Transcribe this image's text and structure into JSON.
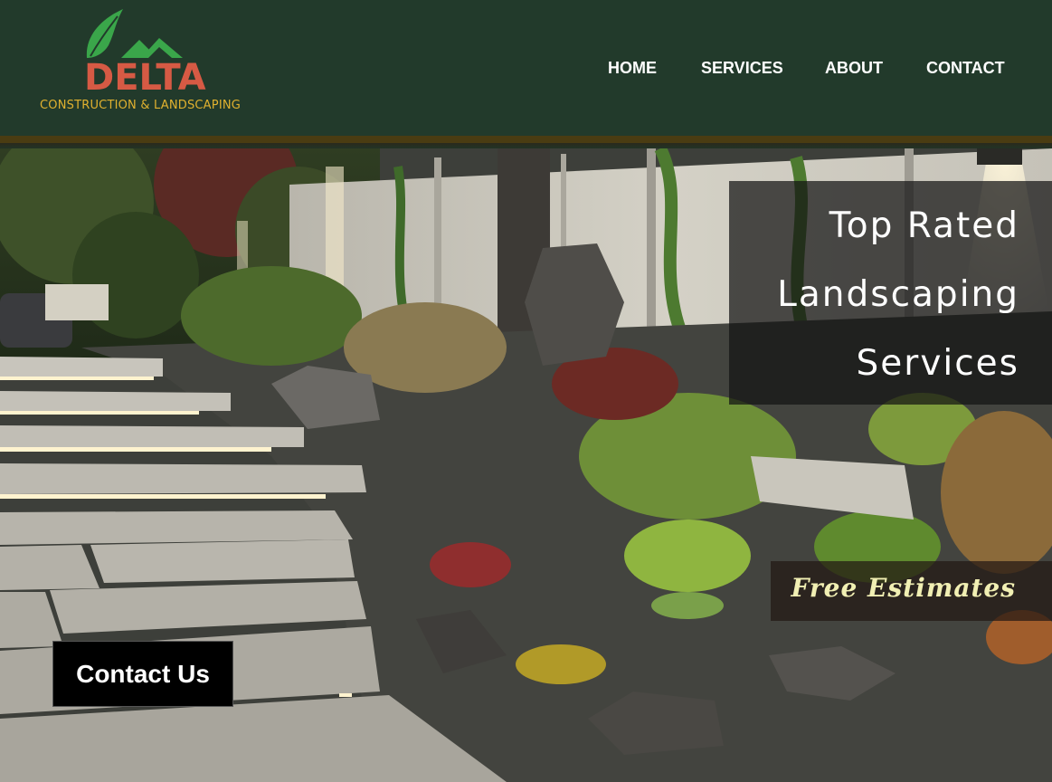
{
  "brand": {
    "name": "DELTA",
    "tagline": "CONSTRUCTION & LANDSCAPING",
    "colors": {
      "leaf": "#3aa64a",
      "word": "#d65a44",
      "tagline": "#e0b12f"
    }
  },
  "nav": {
    "items": [
      {
        "label": "HOME"
      },
      {
        "label": "SERVICES"
      },
      {
        "label": "ABOUT"
      },
      {
        "label": "CONTACT"
      }
    ]
  },
  "hero": {
    "headline": [
      "Top Rated",
      "Landscaping",
      "Services"
    ],
    "badge": "Free Estimates",
    "cta_label": "Contact Us",
    "image_semantic": "landscaped-garden-path-photo"
  },
  "colors": {
    "header_bg": "#223a2b",
    "accent_rule": "#4a3c12",
    "badge_text": "#f1efb3",
    "cta_bg": "#000000"
  }
}
